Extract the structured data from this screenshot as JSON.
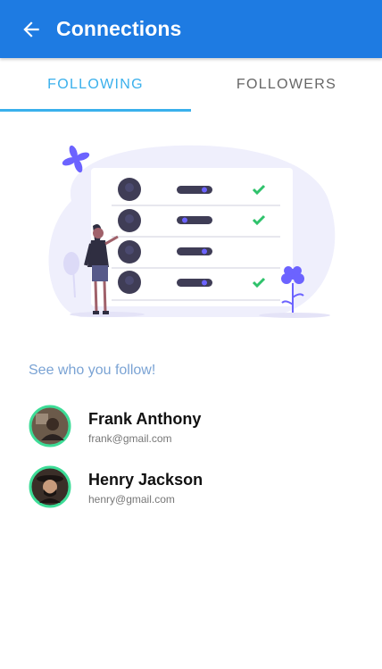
{
  "header": {
    "title": "Connections",
    "back_icon": "arrow-left-icon"
  },
  "tabs": [
    {
      "label": "FOLLOWING",
      "active": true
    },
    {
      "label": "FOLLOWERS",
      "active": false
    }
  ],
  "illustration": {
    "rows": 4,
    "checkmarks": [
      true,
      true,
      false,
      true
    ]
  },
  "section": {
    "subtitle": "See who you follow!"
  },
  "contacts": [
    {
      "name": "Frank Anthony",
      "email": "frank@gmail.com"
    },
    {
      "name": "Henry Jackson",
      "email": "henry@gmail.com"
    }
  ],
  "colors": {
    "primary": "#1e7be2",
    "accent": "#3ab0ec",
    "avatar_ring": "#3ddc97",
    "check": "#2fc26b",
    "illustration": "#6c63ff"
  }
}
